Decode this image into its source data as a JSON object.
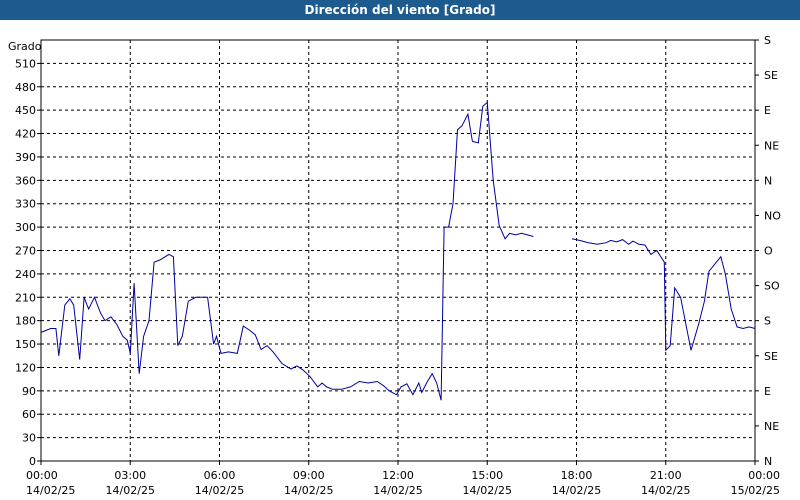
{
  "window": {
    "title": "Dirección del viento [Grado]"
  },
  "chart_data": {
    "type": "line",
    "title": "Dirección del viento [Grado]",
    "ylabel": "Grado",
    "ylim": [
      0,
      540
    ],
    "yticks": [
      0,
      30,
      60,
      90,
      120,
      150,
      180,
      210,
      240,
      270,
      300,
      330,
      360,
      390,
      420,
      450,
      480,
      510
    ],
    "right_axis": {
      "ticks": [
        0,
        45,
        90,
        135,
        180,
        225,
        270,
        315,
        360,
        405,
        450,
        495,
        540
      ],
      "labels": [
        "N",
        "NE",
        "E",
        "SE",
        "S",
        "SO",
        "O",
        "NO",
        "N",
        "NE",
        "E",
        "SE",
        "S"
      ]
    },
    "x_ticks": [
      {
        "t": 0,
        "time": "00:00",
        "date": "14/02/25"
      },
      {
        "t": 3,
        "time": "03:00",
        "date": "14/02/25"
      },
      {
        "t": 6,
        "time": "06:00",
        "date": "14/02/25"
      },
      {
        "t": 9,
        "time": "09:00",
        "date": "14/02/25"
      },
      {
        "t": 12,
        "time": "12:00",
        "date": "14/02/25"
      },
      {
        "t": 15,
        "time": "15:00",
        "date": "14/02/25"
      },
      {
        "t": 18,
        "time": "18:00",
        "date": "14/02/25"
      },
      {
        "t": 21,
        "time": "21:00",
        "date": "14/02/25"
      },
      {
        "t": 24,
        "time": "00:00",
        "date": "15/02/25"
      }
    ],
    "grid": true,
    "line_color": "#0000a0",
    "series": [
      {
        "segments": [
          [
            [
              0.0,
              165
            ],
            [
              0.33,
              170
            ],
            [
              0.5,
              170
            ],
            [
              0.6,
              135
            ],
            [
              0.8,
              200
            ],
            [
              0.97,
              208
            ],
            [
              1.1,
              200
            ],
            [
              1.3,
              130
            ],
            [
              1.45,
              210
            ],
            [
              1.6,
              195
            ],
            [
              1.8,
              210
            ],
            [
              2.0,
              190
            ],
            [
              2.15,
              180
            ],
            [
              2.35,
              185
            ],
            [
              2.55,
              175
            ],
            [
              2.75,
              160
            ],
            [
              2.9,
              155
            ],
            [
              3.0,
              138
            ],
            [
              3.13,
              228
            ],
            [
              3.3,
              112
            ],
            [
              3.45,
              160
            ],
            [
              3.63,
              180
            ],
            [
              3.8,
              255
            ],
            [
              4.0,
              258
            ],
            [
              4.3,
              265
            ],
            [
              4.45,
              262
            ],
            [
              4.6,
              148
            ],
            [
              4.75,
              160
            ],
            [
              4.95,
              205
            ],
            [
              5.2,
              210
            ],
            [
              5.6,
              210
            ],
            [
              5.8,
              150
            ],
            [
              5.9,
              160
            ],
            [
              6.05,
              138
            ],
            [
              6.3,
              140
            ],
            [
              6.6,
              138
            ],
            [
              6.8,
              173
            ],
            [
              7.0,
              168
            ],
            [
              7.2,
              162
            ],
            [
              7.4,
              143
            ],
            [
              7.6,
              148
            ],
            [
              7.8,
              140
            ],
            [
              8.1,
              125
            ],
            [
              8.4,
              118
            ],
            [
              8.6,
              122
            ],
            [
              8.8,
              117
            ],
            [
              9.05,
              108
            ],
            [
              9.3,
              95
            ],
            [
              9.45,
              100
            ],
            [
              9.6,
              95
            ],
            [
              9.8,
              92
            ],
            [
              10.1,
              92
            ],
            [
              10.4,
              95
            ],
            [
              10.7,
              102
            ],
            [
              11.0,
              100
            ],
            [
              11.3,
              102
            ],
            [
              11.5,
              97
            ],
            [
              11.7,
              90
            ],
            [
              11.95,
              85
            ],
            [
              12.1,
              95
            ],
            [
              12.3,
              99
            ],
            [
              12.5,
              85
            ],
            [
              12.7,
              100
            ],
            [
              12.8,
              88
            ],
            [
              13.0,
              103
            ],
            [
              13.15,
              112
            ],
            [
              13.3,
              100
            ],
            [
              13.45,
              78
            ],
            [
              13.55,
              300
            ],
            [
              13.7,
              300
            ],
            [
              13.85,
              330
            ],
            [
              14.0,
              425
            ],
            [
              14.15,
              430
            ],
            [
              14.35,
              445
            ],
            [
              14.5,
              410
            ],
            [
              14.7,
              408
            ],
            [
              14.85,
              455
            ],
            [
              15.0,
              460
            ],
            [
              15.2,
              360
            ],
            [
              15.4,
              302
            ],
            [
              15.6,
              285
            ],
            [
              15.75,
              292
            ],
            [
              15.95,
              290
            ],
            [
              16.15,
              292
            ],
            [
              16.35,
              290
            ],
            [
              16.55,
              288
            ]
          ],
          [
            [
              17.85,
              285
            ],
            [
              18.1,
              283
            ],
            [
              18.4,
              280
            ],
            [
              18.7,
              278
            ],
            [
              19.0,
              280
            ],
            [
              19.15,
              283
            ],
            [
              19.35,
              281
            ],
            [
              19.55,
              284
            ],
            [
              19.75,
              278
            ],
            [
              19.9,
              282
            ],
            [
              20.1,
              278
            ],
            [
              20.3,
              277
            ],
            [
              20.5,
              265
            ],
            [
              20.7,
              270
            ],
            [
              20.95,
              255
            ],
            [
              21.0,
              142
            ],
            [
              21.15,
              148
            ],
            [
              21.3,
              222
            ],
            [
              21.5,
              210
            ],
            [
              21.85,
              142
            ],
            [
              22.1,
              175
            ],
            [
              22.3,
              205
            ],
            [
              22.45,
              243
            ],
            [
              22.7,
              255
            ],
            [
              22.85,
              262
            ],
            [
              23.0,
              240
            ],
            [
              23.2,
              195
            ],
            [
              23.4,
              172
            ],
            [
              23.6,
              170
            ],
            [
              23.8,
              172
            ],
            [
              24.0,
              170
            ]
          ]
        ]
      }
    ]
  }
}
